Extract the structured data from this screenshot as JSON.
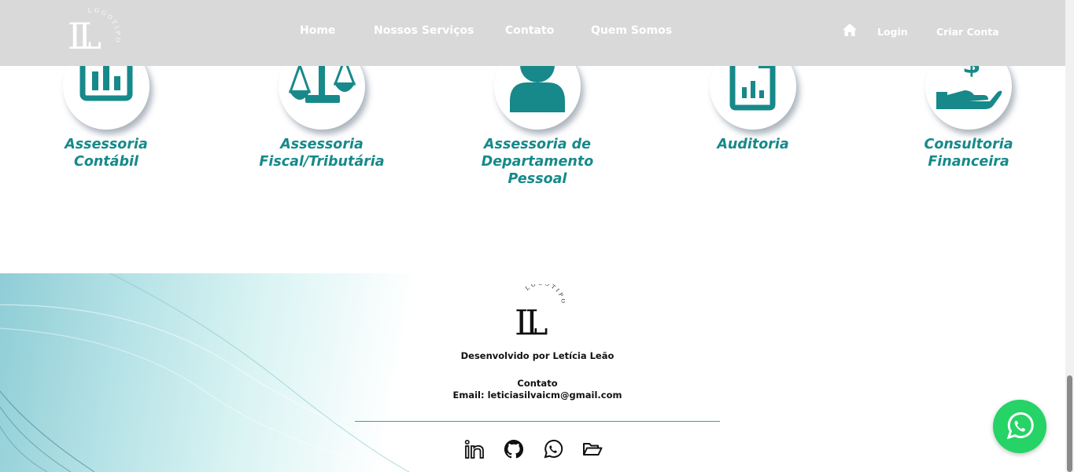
{
  "header": {
    "logo_letters": "LL",
    "logo_ring_text": "LOGOTIPO",
    "nav": [
      {
        "label": "Home"
      },
      {
        "label": "Nossos Serviços"
      },
      {
        "label": "Contato"
      },
      {
        "label": "Quem Somos"
      }
    ],
    "home_icon": "home-icon",
    "login_label": "Login",
    "signup_label": "Criar Conta"
  },
  "services": [
    {
      "icon": "chart-report-icon",
      "line1": "Assessoria",
      "line2": "Contábil",
      "line3": ""
    },
    {
      "icon": "scale-icon",
      "line1": "Assessoria",
      "line2": "Fiscal/Tributária",
      "line3": ""
    },
    {
      "icon": "person-icon",
      "line1": "Assessoria de",
      "line2": "Departamento",
      "line3": "Pessoal"
    },
    {
      "icon": "file-chart-icon",
      "line1": "Auditoria",
      "line2": "",
      "line3": ""
    },
    {
      "icon": "hand-dollar-icon",
      "line1": "Consultoria",
      "line2": "Financeira",
      "line3": ""
    }
  ],
  "footer": {
    "logo_letters": "LL",
    "logo_ring_text": "LOGOTIPO",
    "developed_by": "Desenvolvido por Letícia Leão",
    "contact_heading": "Contato",
    "email_line": "Email: leticiasilvaicm@gmail.com",
    "social": [
      "linkedin-icon",
      "github-icon",
      "whatsapp-icon",
      "folder-icon"
    ]
  },
  "floating_whatsapp": "whatsapp-icon",
  "colors": {
    "header_bg": "#d9d9d9",
    "accent_teal": "#17898a",
    "whatsapp_green": "#25d366"
  }
}
